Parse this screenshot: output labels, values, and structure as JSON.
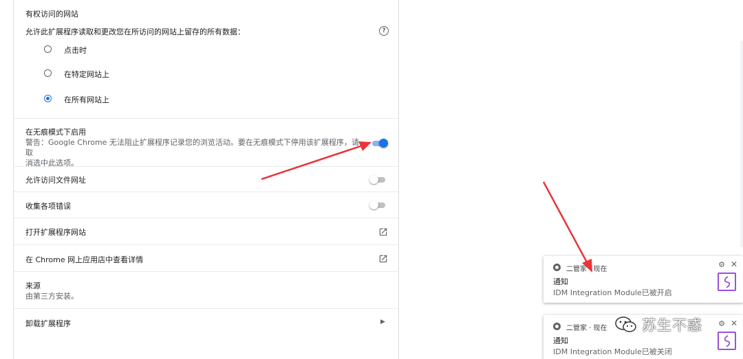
{
  "site_access": {
    "title": "有权访问的网站",
    "desc": "允许此扩展程序读取和更改您在所访问的网站上留存的所有数据：",
    "options": [
      {
        "label": "点击时",
        "selected": false
      },
      {
        "label": "在特定网站上",
        "selected": false
      },
      {
        "label": "在所有网站上",
        "selected": true
      }
    ]
  },
  "incognito": {
    "title": "在无痕模式下启用",
    "warning_line1": "警告：Google Chrome 无法阻止扩展程序记录您的浏览活动。要在无痕模式下停用该扩展程序，请取",
    "warning_line2": "消选中此选项。",
    "enabled": true
  },
  "file_urls": {
    "title": "允许访问文件网址",
    "enabled": false
  },
  "errors": {
    "title": "收集各项错误",
    "enabled": false
  },
  "open_site": {
    "title": "打开扩展程序网站"
  },
  "store": {
    "title": "在 Chrome 网上应用店中查看详情"
  },
  "source": {
    "title": "来源",
    "value": "由第三方安装。"
  },
  "uninstall": {
    "title": "卸载扩展程序"
  },
  "notifications": [
    {
      "source": "二管家 · 现在",
      "title": "通知",
      "message": "IDM Integration Module已被开启"
    },
    {
      "source": "二管家 · 现在",
      "title": "通知",
      "message": "IDM Integration Module已被关闭"
    }
  ],
  "watermark": {
    "text": "苏生不惑"
  },
  "colors": {
    "accent": "#1a73e8",
    "arrow": "#e8343a",
    "app_icon": "#9c4fd8"
  }
}
